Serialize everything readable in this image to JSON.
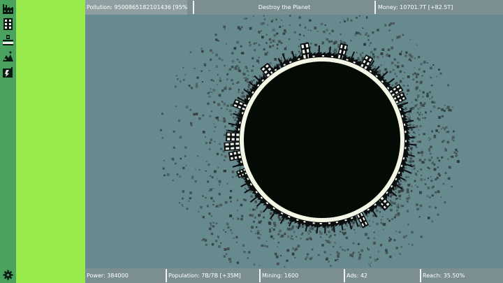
{
  "header": {
    "pollution": "Pollution: 9500865182101436 [95%]",
    "title": "Destroy the Planet",
    "money": "Money: 10701.7T [+82.5T]"
  },
  "footer": {
    "power": "Power: 384000",
    "population": "Population: 7B/7B [+35M]",
    "mining": "Mining: 1600",
    "ads": "Ads: 42",
    "reach": "Reach: 35.50%"
  },
  "rail": {
    "items": [
      {
        "icon": "factory-icon"
      },
      {
        "icon": "building-icon"
      },
      {
        "icon": "power-plant-icon"
      },
      {
        "icon": "mine-icon"
      },
      {
        "icon": "ad-icon"
      }
    ],
    "settings_icon": "gear-icon"
  },
  "colors": {
    "rail": "#4aa25f",
    "panel": "#98ea4c",
    "sky": "#678a8e",
    "planet_core": "#040b05",
    "planet_ring": "#f4f6e6",
    "bar": "#7b8f91"
  }
}
